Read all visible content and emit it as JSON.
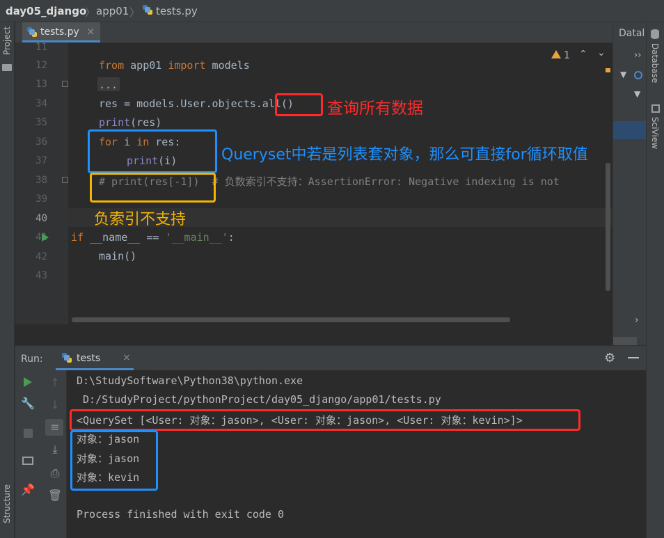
{
  "breadcrumb": {
    "project": "day05_django",
    "folder": "app01",
    "file": "tests.py"
  },
  "left_strip": {
    "project_label": "Project",
    "structure_label": "Structure"
  },
  "right_strip": {
    "database_label": "Database",
    "sciview_label": "SciView"
  },
  "tab": {
    "label": "tests.py",
    "close": "×"
  },
  "db_panel": {
    "title": "Datal",
    "expand": "››"
  },
  "inspection": {
    "warning_count": "1"
  },
  "editor": {
    "lines": [
      {
        "num": "11"
      },
      {
        "num": "12"
      },
      {
        "num": "13"
      },
      {
        "num": "34"
      },
      {
        "num": "35"
      },
      {
        "num": "36"
      },
      {
        "num": "37"
      },
      {
        "num": "38"
      },
      {
        "num": "39"
      },
      {
        "num": "40"
      },
      {
        "num": "41"
      },
      {
        "num": "42"
      },
      {
        "num": "43"
      }
    ],
    "tokens": {
      "l12_from": "from",
      "l12_mid": " app01 ",
      "l12_import": "import",
      "l12_end": " models",
      "l13": "...",
      "l34": "res = models.User.objects.all()",
      "l35_print": "print",
      "l35_rest": "(res)",
      "l36_for": "for",
      "l36_mid": " i ",
      "l36_in": "in",
      "l36_end": " res:",
      "l37_print": "print",
      "l37_rest": "(i)",
      "l38": "# print(res[-1])  # 负数索引不支持：AssertionError: Negative indexing is not",
      "l41_if": "if",
      "l41_mid": " __name__ == ",
      "l41_str": "'__main__'",
      "l41_end": ":",
      "l42": "main()"
    }
  },
  "annotations": {
    "all": "查询所有数据",
    "iterate": "Queryset中若是列表套对象，那么可直接for循环取值",
    "negative": "负索引不支持"
  },
  "run": {
    "label": "Run:",
    "tab_label": "tests",
    "tab_close": "×",
    "output": [
      "D:\\StudySoftware\\Python38\\python.exe",
      " D:/StudyProject/pythonProject/day05_django/app01/tests.py",
      "<QuerySet [<User: 对象：jason>, <User: 对象：jason>, <User: 对象：kevin>]>",
      "对象：jason",
      "对象：jason",
      "对象：kevin",
      "",
      "Process finished with exit code 0"
    ]
  },
  "colors": {
    "red": "#ff2a2a",
    "blue": "#1e90ff",
    "yellow": "#f4b400",
    "accent": "#4a88c7"
  }
}
